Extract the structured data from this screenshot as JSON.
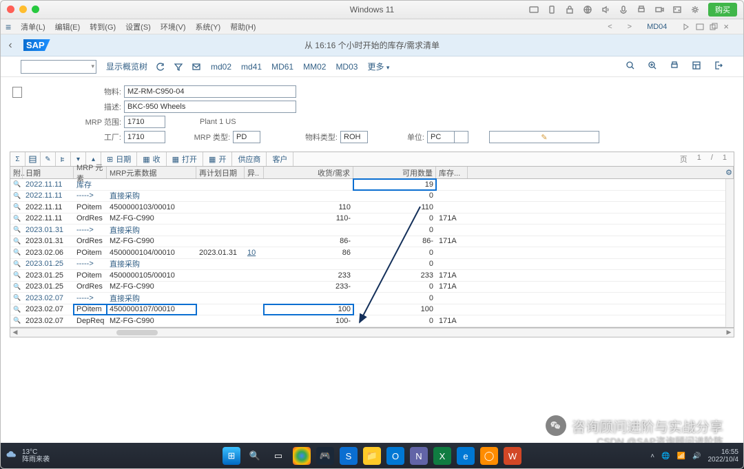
{
  "os": {
    "title": "Windows 11",
    "buy": "购买"
  },
  "winmenu": {
    "items": [
      "清单(L)",
      "编辑(E)",
      "转到(G)",
      "设置(S)",
      "环境(V)",
      "系统(Y)",
      "帮助(H)"
    ],
    "tcode": "MD04"
  },
  "sap": {
    "logo": "SAP",
    "title": "从 16:16 个小时开始的库存/需求清单"
  },
  "toolbar": {
    "showtree": "显示概览树",
    "tcodes": [
      "md02",
      "md41",
      "MD61",
      "MM02",
      "MD03"
    ],
    "more": "更多"
  },
  "form": {
    "material_lbl": "物料:",
    "material": "MZ-RM-C950-04",
    "desc_lbl": "描述:",
    "desc": "BKC-950 Wheels",
    "mrparea_lbl": "MRP 范围:",
    "mrparea": "1710",
    "mrparea_txt": "Plant 1 US",
    "plant_lbl": "工厂:",
    "plant": "1710",
    "mrptype_lbl": "MRP 类型:",
    "mrptype": "PD",
    "mattype_lbl": "物料类型:",
    "mattype": "ROH",
    "uom_lbl": "单位:",
    "uom": "PC"
  },
  "gridtb": {
    "date": "日期",
    "receive": "收",
    "open1": "打开",
    "open2": "开",
    "vendor": "供应商",
    "customer": "客户",
    "page": "页",
    "cur": "1",
    "sep": "/",
    "tot": "1"
  },
  "cols": {
    "c0": "附..",
    "c1": "日期",
    "c2": "MRP 元素",
    "c3": "MRP元素数据",
    "c4": "再计划日期",
    "c5": "异..",
    "c6": "收货/需求",
    "c7": "可用数量",
    "c8": "库存..."
  },
  "rows": [
    {
      "d": "2022.11.11",
      "el": "库存",
      "dat": "",
      "rp": "",
      "ex": "",
      "rq": "",
      "av": "19",
      "sl": "",
      "blue": true,
      "hlav": true
    },
    {
      "d": "2022.11.11",
      "el": "----->",
      "dat": "直接采购",
      "rp": "",
      "ex": "",
      "rq": "",
      "av": "0",
      "sl": "",
      "blue": true
    },
    {
      "d": "2022.11.11",
      "el": "POitem",
      "dat": "4500000103/00010",
      "rp": "",
      "ex": "",
      "rq": "110",
      "av": "110",
      "sl": ""
    },
    {
      "d": "2022.11.11",
      "el": "OrdRes",
      "dat": "MZ-FG-C990",
      "rp": "",
      "ex": "",
      "rq": "110-",
      "av": "0",
      "sl": "171A"
    },
    {
      "d": "2023.01.31",
      "el": "----->",
      "dat": "直接采购",
      "rp": "",
      "ex": "",
      "rq": "",
      "av": "0",
      "sl": "",
      "blue": true
    },
    {
      "d": "2023.01.31",
      "el": "OrdRes",
      "dat": "MZ-FG-C990",
      "rp": "",
      "ex": "",
      "rq": "86-",
      "av": "86-",
      "sl": "171A"
    },
    {
      "d": "2023.02.06",
      "el": "POitem",
      "dat": "4500000104/00010",
      "rp": "2023.01.31",
      "ex": "10",
      "rq": "86",
      "av": "0",
      "sl": "",
      "exlink": true
    },
    {
      "d": "2023.01.25",
      "el": "----->",
      "dat": "直接采购",
      "rp": "",
      "ex": "",
      "rq": "",
      "av": "0",
      "sl": "",
      "blue": true
    },
    {
      "d": "2023.01.25",
      "el": "POitem",
      "dat": "4500000105/00010",
      "rp": "",
      "ex": "",
      "rq": "233",
      "av": "233",
      "sl": "171A"
    },
    {
      "d": "2023.01.25",
      "el": "OrdRes",
      "dat": "MZ-FG-C990",
      "rp": "",
      "ex": "",
      "rq": "233-",
      "av": "0",
      "sl": "171A"
    },
    {
      "d": "2023.02.07",
      "el": "----->",
      "dat": "直接采购",
      "rp": "",
      "ex": "",
      "rq": "",
      "av": "0",
      "sl": "",
      "blue": true
    },
    {
      "d": "2023.02.07",
      "el": "POitem",
      "dat": "4500000107/00010",
      "rp": "",
      "ex": "",
      "rq": "100",
      "av": "100",
      "sl": "",
      "hlrow": true
    },
    {
      "d": "2023.02.07",
      "el": "DepReq",
      "dat": "MZ-FG-C990",
      "rp": "",
      "ex": "",
      "rq": "100-",
      "av": "0",
      "sl": "171A"
    }
  ],
  "watermark": {
    "line1": "咨询顾问进阶与实战分享",
    "line2": "CSDN @SAP咨询顾问进阶陈"
  },
  "weather": {
    "temp": "13°C",
    "cond": "阵雨来袭"
  },
  "clock": {
    "time": "16:55",
    "date": "2022/10/4"
  }
}
